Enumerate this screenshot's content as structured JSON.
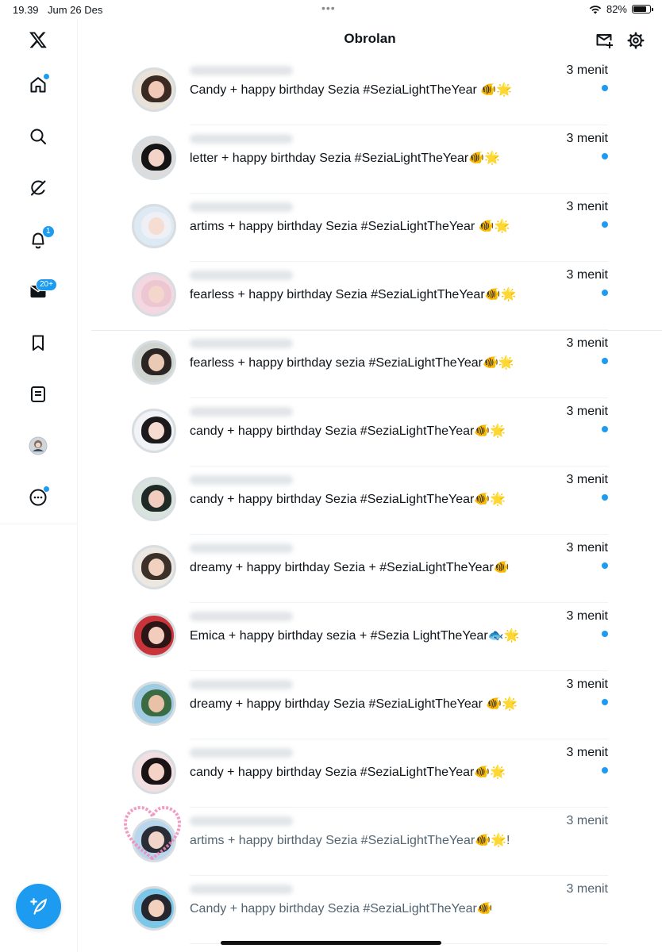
{
  "status_bar": {
    "time": "19.39",
    "date": "Jum 26 Des",
    "battery_text": "82%",
    "battery_level": 0.82
  },
  "sidebar": {
    "items": [
      {
        "name": "home",
        "icon": "home-icon",
        "has_dot": true
      },
      {
        "name": "search",
        "icon": "search-icon"
      },
      {
        "name": "grok",
        "icon": "grok-icon"
      },
      {
        "name": "notifications",
        "icon": "bell-icon",
        "badge": "1"
      },
      {
        "name": "messages",
        "icon": "envelope-icon",
        "badge": "20+"
      },
      {
        "name": "bookmarks",
        "icon": "bookmark-icon"
      },
      {
        "name": "lists",
        "icon": "list-icon"
      },
      {
        "name": "profile",
        "icon": "avatar"
      },
      {
        "name": "more",
        "icon": "more-icon",
        "has_dot": true
      }
    ],
    "compose_icon": "feather-plus-icon"
  },
  "header": {
    "title": "Obrolan",
    "new_message_icon": "new-message-icon",
    "settings_icon": "gear-icon"
  },
  "conversations": [
    {
      "time": "3 menit",
      "message": "Candy + happy birthday Sezia #SeziaLightTheYear 🐠🌟",
      "unread": true
    },
    {
      "time": "3 menit",
      "message": "letter + happy birthday Sezia #SeziaLightTheYear🐠🌟",
      "unread": true
    },
    {
      "time": "3 menit",
      "message": "artims + happy birthday Sezia #SeziaLightTheYear 🐠🌟",
      "unread": true
    },
    {
      "time": "3 menit",
      "message": "fearless + happy birthday Sezia #SeziaLightTheYear🐠🌟",
      "unread": true
    },
    {
      "time": "3 menit",
      "message": "fearless + happy birthday sezia #SeziaLightTheYear🐠🌟",
      "unread": true
    },
    {
      "time": "3 menit",
      "message": "candy + happy birthday Sezia #SeziaLightTheYear🐠🌟",
      "unread": true
    },
    {
      "time": "3 menit",
      "message": "candy + happy birthday Sezia #SeziaLightTheYear🐠🌟",
      "unread": true
    },
    {
      "time": "3 menit",
      "message": "dreamy + happy birthday Sezia + #SeziaLightTheYear🐠",
      "unread": true
    },
    {
      "time": "3 menit",
      "message": "Emica + happy birthday sezia + #Sezia LightTheYear🐟🌟",
      "unread": true
    },
    {
      "time": "3 menit",
      "message": "dreamy + happy birthday Sezia #SeziaLightTheYear 🐠🌟",
      "unread": true
    },
    {
      "time": "3 menit",
      "message": "candy + happy birthday Sezia #SeziaLightTheYear🐠🌟",
      "unread": true
    },
    {
      "time": "3 menit",
      "message": "artims + happy birthday Sezia  #SeziaLightTheYear🐠🌟!",
      "unread": false
    },
    {
      "time": "3 menit",
      "message": "Candy + happy birthday Sezia #SeziaLightTheYear🐠",
      "unread": false
    }
  ]
}
